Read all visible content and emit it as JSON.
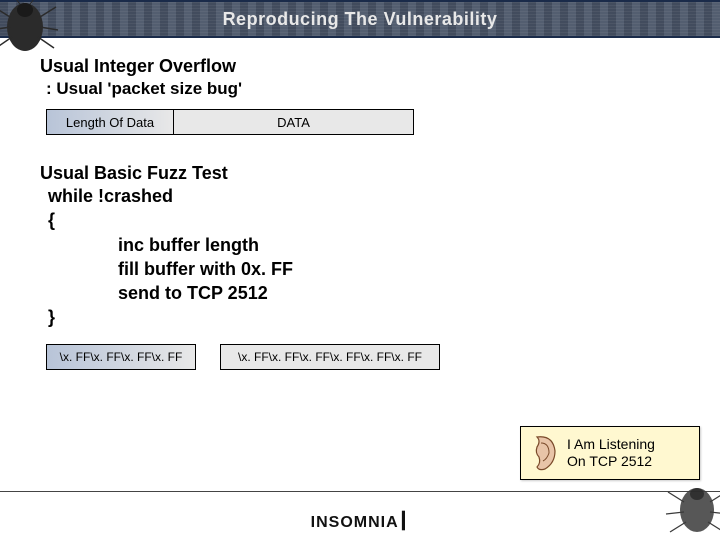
{
  "banner_title": "Reproducing The Vulnerability",
  "section1": {
    "title": "Usual Integer Overflow",
    "subtitle": ": Usual 'packet size bug'",
    "packet_len_label": "Length Of Data",
    "packet_data_label": "DATA"
  },
  "section2": {
    "title": "Usual Basic Fuzz Test",
    "code_line1": "while !crashed",
    "code_open": "{",
    "code_body1": "inc buffer length",
    "code_body2": "fill buffer with 0x. FF",
    "code_body3": "send to TCP 2512",
    "code_close": "}"
  },
  "packet2": {
    "cell1": "\\x. FF\\x. FF\\x. FF\\x. FF",
    "cell2": "\\x. FF\\x. FF\\x. FF\\x. FF\\x. FF\\x. FF"
  },
  "listen": {
    "line1": "I Am Listening",
    "line2": "On TCP 2512"
  },
  "footer_brand": "INSOMNIA"
}
